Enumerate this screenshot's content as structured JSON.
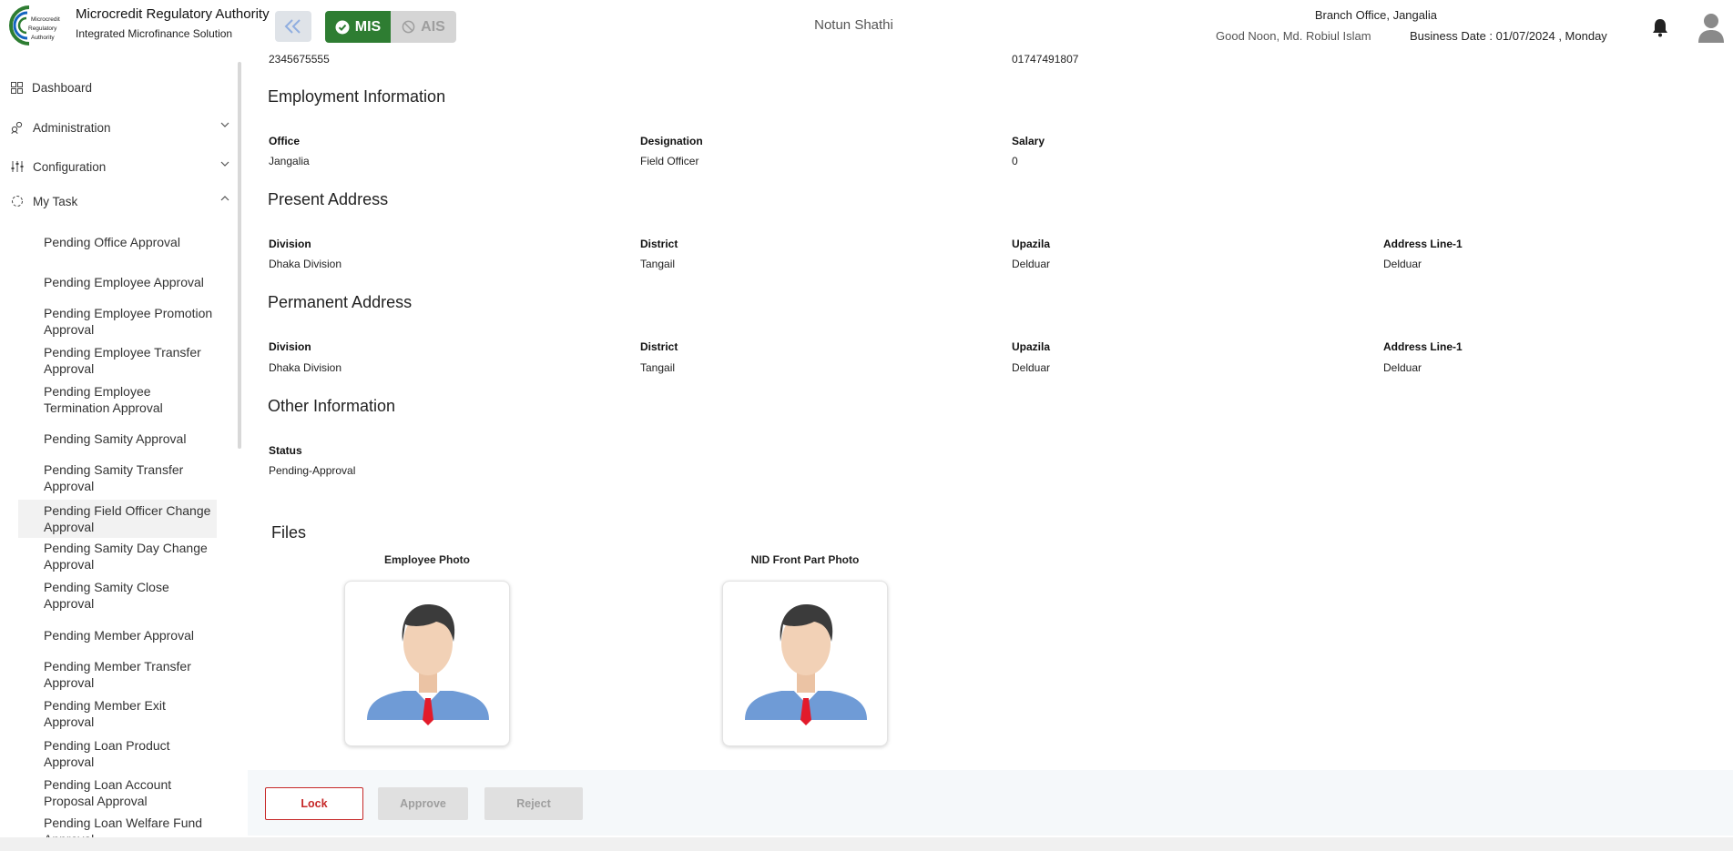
{
  "header": {
    "app_title": "Microcredit Regulatory Authority",
    "app_subtitle": "Integrated Microfinance Solution",
    "logo_text": [
      "Microcredit",
      "Regulatory",
      "Authority"
    ],
    "mode_mis_label": "MIS",
    "mode_ais_label": "AIS",
    "center_title": "Notun Shathi",
    "greeting": "Good Noon, Md. Robiul Islam",
    "branch": "Branch Office, Jangalia",
    "business_date": "Business Date : 01/07/2024 , Monday",
    "accent_color": "#2e7d32"
  },
  "sidebar": {
    "top_items": [
      {
        "label": "Dashboard",
        "icon": "grid-icon"
      },
      {
        "label": "Administration",
        "icon": "people-icon"
      },
      {
        "label": "Configuration",
        "icon": "sliders-icon"
      },
      {
        "label": "My Task",
        "icon": "spinner-icon"
      }
    ],
    "sub_items": [
      "Pending Office Approval",
      "Pending Employee Approval",
      "Pending Employee Promotion Approval",
      "Pending Employee Transfer Approval",
      "Pending Employee Termination Approval",
      "Pending Samity Approval",
      "Pending Samity Transfer Approval",
      "Pending Field Officer Change Approval",
      "Pending Samity Day Change Approval",
      "Pending Samity Close Approval",
      "Pending Member Approval",
      "Pending Member Transfer Approval",
      "Pending Member Exit Approval",
      "Pending Loan Product Approval",
      "Pending Loan Account Proposal Approval",
      "Pending Loan Welfare Fund Approval"
    ]
  },
  "main": {
    "top_values": {
      "left": "2345675555",
      "right": "01747491807"
    },
    "employment": {
      "title": "Employment Information",
      "office_label": "Office",
      "office_value": "Jangalia",
      "designation_label": "Designation",
      "designation_value": "Field Officer",
      "salary_label": "Salary",
      "salary_value": "0"
    },
    "present": {
      "title": "Present Address",
      "division_label": "Division",
      "division_value": "Dhaka Division",
      "district_label": "District",
      "district_value": "Tangail",
      "upazila_label": "Upazila",
      "upazila_value": "Delduar",
      "line1_label": "Address Line-1",
      "line1_value": "Delduar"
    },
    "permanent": {
      "title": "Permanent Address",
      "division_label": "Division",
      "division_value": "Dhaka Division",
      "district_label": "District",
      "district_value": "Tangail",
      "upazila_label": "Upazila",
      "upazila_value": "Delduar",
      "line1_label": "Address Line-1",
      "line1_value": "Delduar"
    },
    "other": {
      "title": "Other Information",
      "status_label": "Status",
      "status_value": "Pending-Approval"
    },
    "files": {
      "title": "Files",
      "employee_photo_label": "Employee Photo",
      "nid_photo_label": "NID Front Part Photo"
    },
    "actions": {
      "lock": "Lock",
      "approve": "Approve",
      "reject": "Reject"
    }
  }
}
